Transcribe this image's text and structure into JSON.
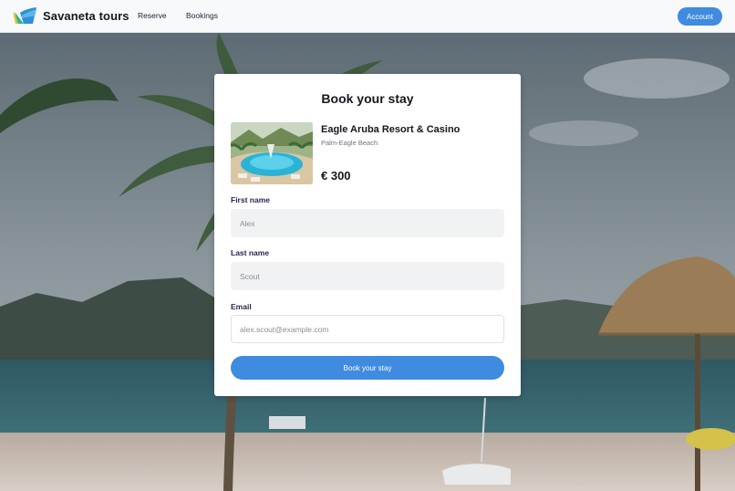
{
  "header": {
    "brand": "Savaneta tours",
    "nav": {
      "reserve": "Reserve",
      "bookings": "Bookings"
    },
    "account_label": "Account"
  },
  "booking": {
    "title": "Book your stay",
    "hotel": {
      "name": "Eagle Aruba Resort & Casino",
      "location": "Palm-Eagle Beach",
      "price": "€ 300"
    },
    "fields": {
      "first_name_label": "First name",
      "first_name_placeholder": "Alex",
      "last_name_label": "Last name",
      "last_name_placeholder": "Scout",
      "email_label": "Email",
      "email_placeholder": "alex.scout@example.com"
    },
    "submit_label": "Book your stay"
  },
  "colors": {
    "accent": "#3f8be0",
    "header_bg": "#f7f9fb",
    "card_bg": "#ffffff"
  },
  "icons": {
    "logo": "savaneta-logo-icon"
  }
}
